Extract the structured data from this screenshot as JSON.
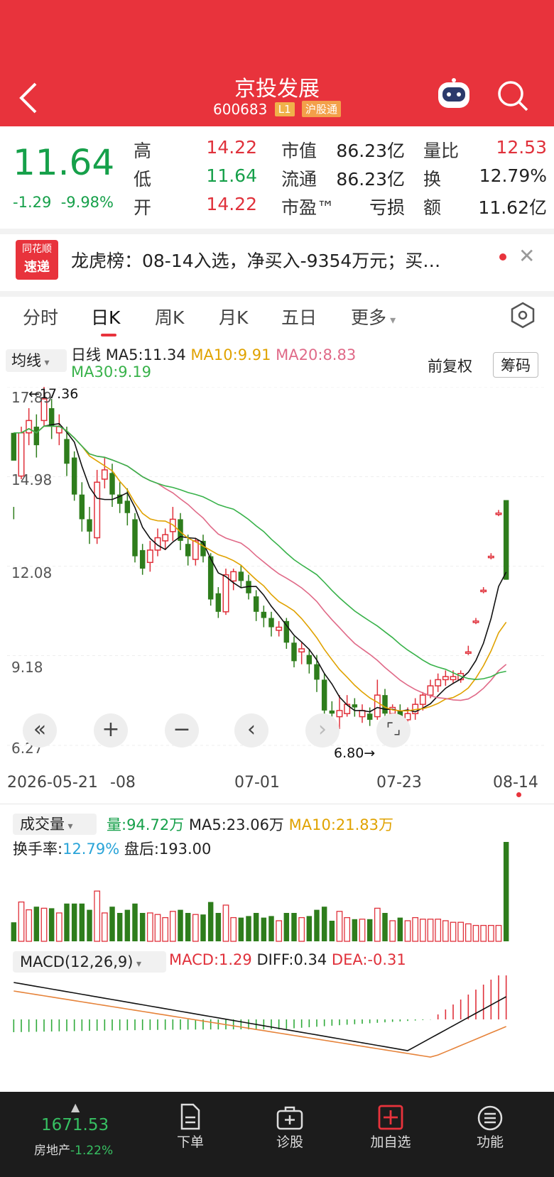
{
  "header": {
    "stock_name": "京投发展",
    "stock_code": "600683",
    "tag_level": "L1",
    "tag_connect": "沪股通"
  },
  "quote": {
    "price": "11.64",
    "change": "-1.29",
    "change_pct": "-9.98%",
    "high_label": "高",
    "high_value": "14.22",
    "low_label": "低",
    "low_value": "11.64",
    "open_label": "开",
    "open_value": "14.22",
    "mktcap_label": "市值",
    "mktcap_value": "86.23亿",
    "float_label": "流通",
    "float_value": "86.23亿",
    "pe_label": "市盈™",
    "pe_value": "亏损",
    "volratio_label": "量比",
    "volratio_value": "12.53",
    "turnover_label": "换",
    "turnover_value": "12.79%",
    "amount_label": "额",
    "amount_value": "11.62亿"
  },
  "news": {
    "logo_line1": "同花顺",
    "logo_line2": "速递",
    "text": "龙虎榜：08-14入选，净买入-9354万元；买…"
  },
  "tabs": [
    "分时",
    "日K",
    "周K",
    "月K",
    "五日",
    "更多"
  ],
  "indicator": {
    "selector": "均线",
    "line_label": "日线",
    "ma5": "MA5:11.34",
    "ma10": "MA10:9.91",
    "ma20": "MA20:8.83",
    "ma30": "MA30:9.19",
    "adjust": "前复权",
    "chips": "筹码"
  },
  "colors": {
    "brand_red": "#e8333c",
    "up_red": "#e0313b",
    "down_green": "#16a04a",
    "ma10": "#e0a200",
    "ma20": "#e06a88",
    "ma30": "#38b24a"
  },
  "chart_data": {
    "type": "candlestick",
    "y_ticks": [
      "17.89",
      "14.98",
      "12.08",
      "9.18",
      "6.27"
    ],
    "x_ticks": [
      "2026-05-21",
      "-08",
      "07-01",
      "07-23",
      "08-14"
    ],
    "annotations": {
      "high": "←17.36",
      "low": "6.80→"
    },
    "ylim": [
      6.27,
      17.89
    ],
    "candles": [
      [
        15.5,
        16.4,
        14.0,
        13.6,
        "d"
      ],
      [
        15.0,
        16.4,
        16.6,
        14.9,
        "u"
      ],
      [
        16.4,
        16.8,
        17.2,
        16.0,
        "u"
      ],
      [
        16.6,
        16.0,
        17.0,
        15.6,
        "d"
      ],
      [
        16.8,
        17.5,
        17.9,
        16.6,
        "u"
      ],
      [
        17.2,
        16.6,
        17.5,
        16.2,
        "d"
      ],
      [
        16.4,
        16.6,
        17.0,
        16.0,
        "u"
      ],
      [
        16.2,
        15.4,
        16.6,
        15.0,
        "d"
      ],
      [
        15.6,
        14.4,
        15.8,
        14.2,
        "d"
      ],
      [
        14.4,
        13.6,
        14.8,
        13.2,
        "d"
      ],
      [
        13.6,
        13.2,
        14.0,
        12.8,
        "d"
      ],
      [
        13.0,
        14.8,
        15.2,
        12.8,
        "u"
      ],
      [
        14.9,
        15.2,
        15.6,
        14.6,
        "u"
      ],
      [
        15.1,
        14.4,
        15.4,
        14.0,
        "d"
      ],
      [
        14.4,
        14.1,
        14.8,
        13.8,
        "d"
      ],
      [
        14.2,
        13.8,
        14.6,
        13.4,
        "d"
      ],
      [
        13.6,
        12.4,
        13.8,
        12.2,
        "d"
      ],
      [
        12.6,
        12.0,
        12.8,
        11.8,
        "d"
      ],
      [
        12.2,
        12.6,
        12.9,
        11.9,
        "u"
      ],
      [
        12.6,
        13.0,
        13.3,
        12.4,
        "u"
      ],
      [
        12.9,
        13.1,
        13.3,
        12.6,
        "u"
      ],
      [
        13.2,
        13.6,
        14.0,
        12.9,
        "u"
      ],
      [
        13.6,
        12.9,
        13.8,
        12.6,
        "d"
      ],
      [
        12.8,
        12.4,
        13.1,
        12.1,
        "d"
      ],
      [
        12.3,
        12.9,
        13.0,
        12.1,
        "u"
      ],
      [
        12.9,
        12.4,
        13.1,
        12.2,
        "d"
      ],
      [
        12.4,
        11.0,
        12.5,
        10.8,
        "d"
      ],
      [
        11.2,
        10.6,
        11.4,
        10.4,
        "d"
      ],
      [
        10.6,
        11.8,
        12.0,
        10.5,
        "u"
      ],
      [
        11.6,
        11.9,
        12.0,
        11.3,
        "u"
      ],
      [
        11.9,
        11.6,
        12.1,
        11.4,
        "d"
      ],
      [
        11.6,
        11.2,
        11.8,
        11.0,
        "d"
      ],
      [
        11.1,
        10.6,
        11.3,
        10.3,
        "d"
      ],
      [
        10.6,
        10.4,
        10.8,
        10.1,
        "d"
      ],
      [
        10.4,
        10.1,
        10.6,
        9.8,
        "d"
      ],
      [
        10.0,
        10.1,
        10.3,
        9.8,
        "u"
      ],
      [
        10.3,
        9.6,
        10.4,
        9.4,
        "d"
      ],
      [
        9.6,
        9.0,
        9.8,
        8.8,
        "d"
      ],
      [
        9.4,
        9.3,
        9.6,
        8.9,
        "u"
      ],
      [
        9.2,
        8.9,
        9.4,
        8.6,
        "d"
      ],
      [
        8.9,
        8.4,
        9.2,
        8.0,
        "d"
      ],
      [
        8.4,
        7.4,
        8.6,
        7.2,
        "d"
      ],
      [
        7.4,
        7.3,
        7.7,
        7.2,
        "d"
      ],
      [
        7.4,
        7.2,
        7.9,
        6.8,
        "u"
      ],
      [
        7.3,
        7.6,
        7.9,
        7.2,
        "u"
      ],
      [
        7.6,
        7.5,
        7.8,
        7.2,
        "d"
      ],
      [
        7.2,
        7.4,
        7.6,
        7.0,
        "u"
      ],
      [
        7.3,
        7.1,
        7.5,
        6.9,
        "d"
      ],
      [
        7.2,
        7.9,
        8.4,
        7.1,
        "u"
      ],
      [
        7.9,
        7.3,
        8.1,
        7.1,
        "d"
      ],
      [
        7.3,
        7.5,
        7.6,
        7.1,
        "u"
      ],
      [
        7.4,
        7.1,
        7.6,
        6.9,
        "d"
      ],
      [
        7.1,
        7.3,
        7.5,
        7.0,
        "u"
      ],
      [
        7.3,
        7.6,
        7.8,
        7.1,
        "u"
      ],
      [
        7.6,
        7.9,
        8.0,
        7.4,
        "u"
      ],
      [
        7.9,
        8.2,
        8.4,
        7.8,
        "u"
      ],
      [
        8.2,
        8.4,
        8.6,
        8.0,
        "u"
      ],
      [
        8.4,
        8.5,
        8.7,
        8.2,
        "u"
      ],
      [
        8.5,
        8.4,
        8.7,
        8.3,
        "u"
      ],
      [
        8.4,
        8.6,
        8.7,
        8.3,
        "u"
      ],
      [
        9.3,
        9.3,
        9.5,
        9.2,
        "u"
      ],
      [
        10.3,
        10.3,
        10.4,
        10.2,
        "u"
      ],
      [
        11.3,
        11.3,
        11.4,
        11.2,
        "u"
      ],
      [
        12.4,
        12.4,
        12.5,
        12.3,
        "u"
      ],
      [
        13.8,
        13.8,
        13.9,
        13.7,
        "u"
      ],
      [
        14.22,
        11.64,
        14.22,
        11.64,
        "d"
      ]
    ],
    "ma_values_last": {
      "MA5": 11.34,
      "MA10": 9.91,
      "MA20": 8.83,
      "MA30": 9.19
    }
  },
  "volume": {
    "selector": "成交量",
    "vol": "量:94.72万",
    "ma5": "MA5:23.06万",
    "ma10": "MA10:21.83万",
    "turnover_label": "换手率:",
    "turnover_value": "12.79%",
    "after_hours": "盘后:193.00"
  },
  "macd": {
    "selector": "MACD(12,26,9)",
    "macd": "MACD:1.29",
    "diff": "DIFF:0.34",
    "dea": "DEA:-0.31"
  },
  "bottom_bar": {
    "index_value": "1671.53",
    "index_name": "房地产",
    "index_change": "-1.22%",
    "items": [
      "下单",
      "诊股",
      "加自选",
      "功能"
    ]
  }
}
